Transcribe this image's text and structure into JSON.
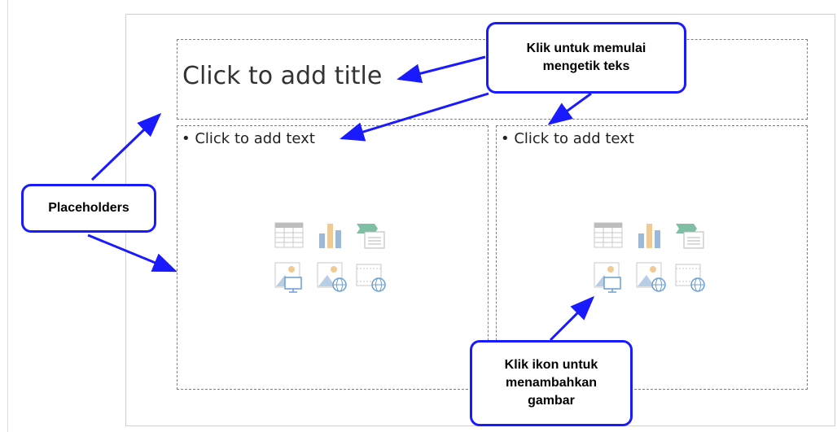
{
  "slide": {
    "title_placeholder": "Click to add title",
    "left_body_placeholder": "• Click to add text",
    "right_body_placeholder": "• Click to add text"
  },
  "content_icons": [
    "table-icon",
    "chart-icon",
    "smartart-icon",
    "picture-icon",
    "online-picture-icon",
    "video-icon"
  ],
  "callouts": {
    "typing": [
      "Klik untuk memulai",
      "mengetik teks"
    ],
    "placeholders": "Placeholders",
    "image": [
      "Klik ikon untuk",
      "menambahkan",
      "gambar"
    ]
  },
  "colors": {
    "callout_border": "#1a1aff",
    "arrow": "#1a1aff",
    "placeholder_border": "#7f7f7f"
  }
}
